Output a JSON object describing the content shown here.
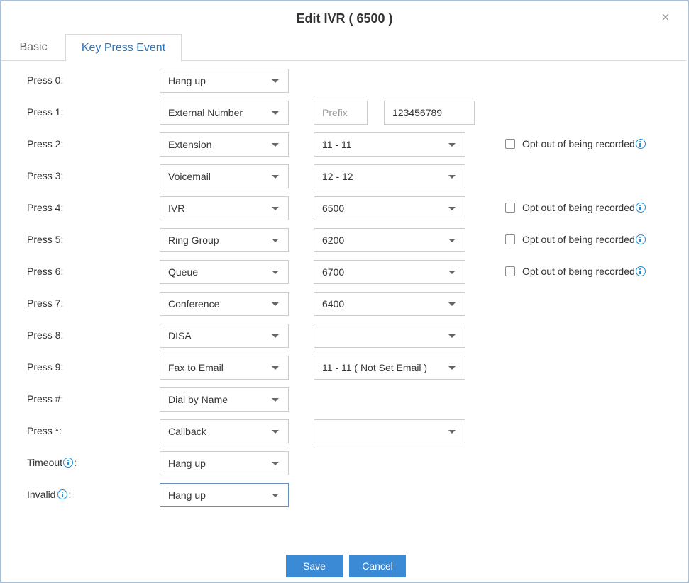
{
  "dialog": {
    "title": "Edit IVR ( 6500 )",
    "close_glyph": "×",
    "tabs": [
      {
        "label": "Basic"
      },
      {
        "label": "Key Press Event"
      }
    ],
    "active_tab": "Key Press Event"
  },
  "opt_out_label": "Opt out of being recorded",
  "rows": {
    "press0": {
      "label": "Press 0:",
      "action": "Hang up"
    },
    "press1": {
      "label": "Press 1:",
      "action": "External Number",
      "prefix_placeholder": "Prefix",
      "number_value": "123456789"
    },
    "press2": {
      "label": "Press 2:",
      "action": "Extension",
      "target": "11 - 11",
      "opt_out": false
    },
    "press3": {
      "label": "Press 3:",
      "action": "Voicemail",
      "target": "12 - 12"
    },
    "press4": {
      "label": "Press 4:",
      "action": "IVR",
      "target": "6500",
      "opt_out": false
    },
    "press5": {
      "label": "Press 5:",
      "action": "Ring Group",
      "target": "6200",
      "opt_out": false
    },
    "press6": {
      "label": "Press 6:",
      "action": "Queue",
      "target": "6700",
      "opt_out": false
    },
    "press7": {
      "label": "Press 7:",
      "action": "Conference",
      "target": "6400"
    },
    "press8": {
      "label": "Press 8:",
      "action": "DISA",
      "target": ""
    },
    "press9": {
      "label": "Press 9:",
      "action": "Fax to Email",
      "target": "11 - 11 ( Not Set Email )"
    },
    "press_hash": {
      "label": "Press #:",
      "action": "Dial by Name"
    },
    "press_star": {
      "label": "Press *:",
      "action": "Callback",
      "target": ""
    },
    "timeout": {
      "label": "Timeout",
      "suffix": ":",
      "action": "Hang up"
    },
    "invalid": {
      "label": "Invalid",
      "suffix": ":",
      "action": "Hang up"
    }
  },
  "buttons": {
    "save": "Save",
    "cancel": "Cancel"
  },
  "colors": {
    "accent": "#2f73b7",
    "button": "#3a8ad6",
    "info_icon": "#1e8fd6",
    "dialog_border": "#a9bfd6"
  },
  "icons": {
    "close": "close-icon",
    "info": "info-icon",
    "caret": "chevron-down-icon"
  }
}
